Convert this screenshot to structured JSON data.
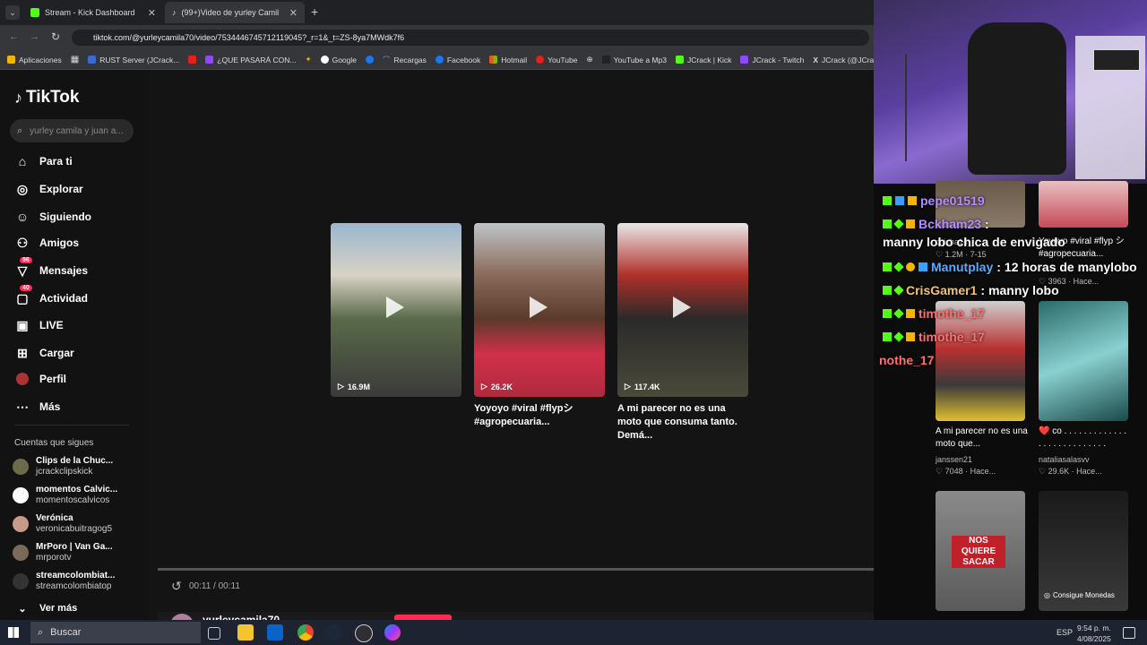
{
  "tabs": [
    {
      "label": "Stream - Kick Dashboard",
      "active": false
    },
    {
      "label": "(99+)Video de yurley Camila la",
      "active": true
    }
  ],
  "url": "tiktok.com/@yurleycamila70/video/7534446745712119045?_r=1&_t=ZS-8ya7MWdk7f6",
  "bookmarks": [
    "Aplicaciones",
    "RUST Server (JCrack...",
    "¿QUE PASARÁ CON...",
    "Google",
    "Recargas",
    "Facebook",
    "Hotmail",
    "YouTube",
    "YouTube a Mp3",
    "JCrack | Kick",
    "JCrack - Twitch",
    "JCrack (@JCrac"
  ],
  "sidebar": {
    "logo": "TikTok",
    "search_placeholder": "yurley camila y juan a...",
    "nav": [
      {
        "label": "Para ti",
        "icon": "home-icon"
      },
      {
        "label": "Explorar",
        "icon": "compass-icon"
      },
      {
        "label": "Siguiendo",
        "icon": "following-icon"
      },
      {
        "label": "Amigos",
        "icon": "friends-icon"
      },
      {
        "label": "Mensajes",
        "icon": "messages-icon",
        "badge": "96"
      },
      {
        "label": "Actividad",
        "icon": "activity-icon",
        "badge": "40"
      },
      {
        "label": "LIVE",
        "icon": "live-icon"
      },
      {
        "label": "Cargar",
        "icon": "upload-icon"
      },
      {
        "label": "Perfil",
        "icon": "profile-icon"
      },
      {
        "label": "Más",
        "icon": "more-icon"
      }
    ],
    "following_header": "Cuentas que sigues",
    "following": [
      {
        "name": "Clips de la Chuc...",
        "user": "jcrackclipskick"
      },
      {
        "name": "momentos Calvic...",
        "user": "momentoscalvicos"
      },
      {
        "name": "Verónica",
        "user": "veronicabuitragog5"
      },
      {
        "name": "MrPoro | Van Ga...",
        "user": "mrporotv"
      },
      {
        "name": "streamcolombiat...",
        "user": "streamcolombiatop"
      }
    ],
    "see_more": "Ver más"
  },
  "videos": [
    {
      "views": "16.9M",
      "title": ""
    },
    {
      "views": "26.2K",
      "title": "Yoyoyo #viral #flypシ #agropecuaria..."
    },
    {
      "views": "117.4K",
      "title": "A mi parecer no es una moto que consuma tanto. Demá..."
    }
  ],
  "player": {
    "time": "00:11 / 00:11",
    "author": "yurleycamila70"
  },
  "chat": [
    {
      "user": "pepe01519",
      "msg": "",
      "color": "#b48cff"
    },
    {
      "user": "Bckham23",
      "msg": "manny lobo chica de envigado",
      "color": "#b48cff"
    },
    {
      "user": "Manutplay",
      "msg": "12 horas de manylobo",
      "color": "#5aa9ff"
    },
    {
      "user": "CrisGamer1",
      "msg": "manny lobo",
      "color": "#f0c27a"
    },
    {
      "user": "timothe_17",
      "msg": "",
      "color": "#ff6f6f"
    },
    {
      "user": "timothe_17",
      "msg": "",
      "color": "#ff6f6f"
    },
    {
      "user": "nothe_17",
      "msg": "",
      "color": "#ff6f6f"
    }
  ],
  "side_cards": [
    {
      "title": "",
      "author": "chicha14_",
      "likes": "1.2M",
      "date": "7-15"
    },
    {
      "title": "Yoyoyo #viral #flyp シ #agropecuaria...",
      "author": "",
      "likes": "3963",
      "date": "Hace..."
    },
    {
      "title": "A mi parecer no es una moto que...",
      "author": "janssen21",
      "likes": "7048",
      "date": "Hace..."
    },
    {
      "title": "❤️ co . . . . . . . . . . . . . . . . . . . . . . . . . . .",
      "author": "nataliasalasvv",
      "likes": "29.6K",
      "date": "Hace..."
    }
  ],
  "side_extra": {
    "badge_text": "NOS QUIERE SACAR",
    "consigue": "Consigue Monedas"
  },
  "taskbar": {
    "search": "Buscar",
    "lang": "ESP",
    "time": "9:54 p. m.",
    "date": "4/08/2025"
  }
}
